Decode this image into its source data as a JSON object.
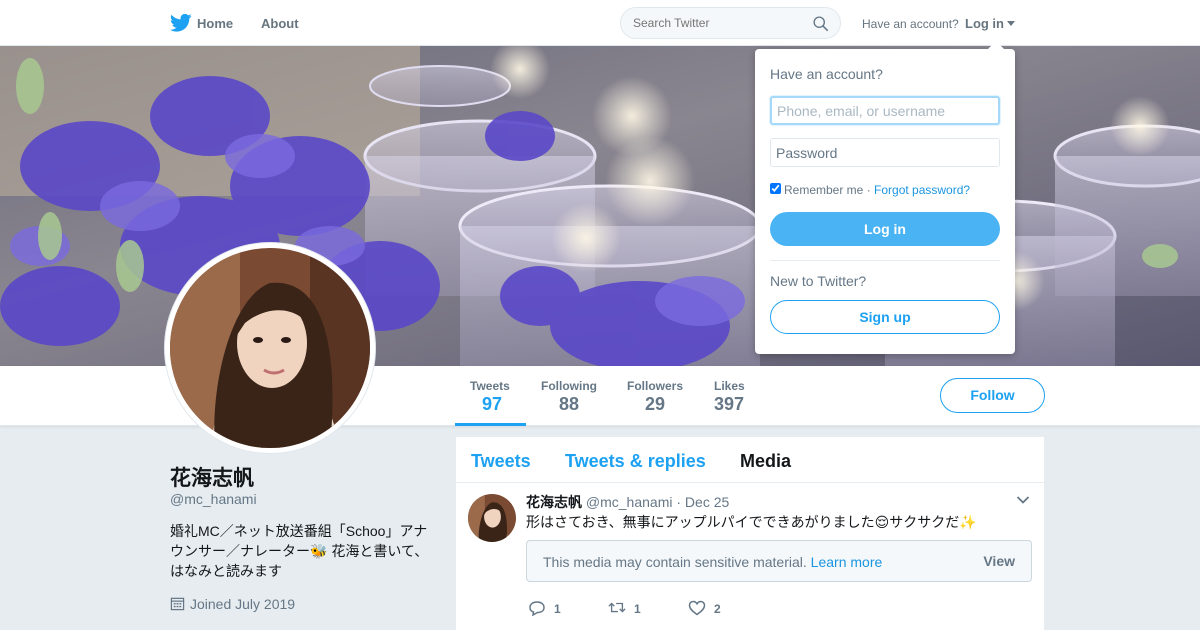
{
  "nav": {
    "home_label": "Home",
    "about_label": "About",
    "search_placeholder": "Search Twitter",
    "have_account": "Have an account?",
    "login_label": "Log in"
  },
  "stats": [
    {
      "label": "Tweets",
      "value": "97"
    },
    {
      "label": "Following",
      "value": "88"
    },
    {
      "label": "Followers",
      "value": "29"
    },
    {
      "label": "Likes",
      "value": "397"
    }
  ],
  "follow_label": "Follow",
  "profile": {
    "name": "花海志帆",
    "handle": "@mc_hanami",
    "bio": "婚礼MC／ネット放送番組「Schoo」アナウンサー／ナレーター🐝 花海と書いて、はなみと読みます",
    "joined": "Joined July 2019"
  },
  "timeline": {
    "tabs": [
      "Tweets",
      "Tweets & replies",
      "Media"
    ],
    "tweet": {
      "name": "花海志帆",
      "handle": "@mc_hanami",
      "date": "Dec 25",
      "text": "形はさておき、無事にアップルパイでできあがりました😌サクサクだ✨",
      "media_warning": "This media may contain sensitive material.",
      "learn_more": "Learn more",
      "view_label": "View",
      "replies": "1",
      "retweets": "1",
      "likes": "2"
    }
  },
  "login_dropdown": {
    "title": "Have an account?",
    "username_placeholder": "Phone, email, or username",
    "password_placeholder": "Password",
    "remember_me": "Remember me",
    "separator": " · ",
    "forgot_password": "Forgot password?",
    "login_button": "Log in",
    "new_to_twitter": "New to Twitter?",
    "signup_button": "Sign up"
  },
  "colors": {
    "brand": "#1da1f2",
    "login_button": "#4ab3f4",
    "background": "#e6ecf0"
  },
  "icons": [
    "twitter-bird-icon",
    "search-icon",
    "caret-down-icon",
    "calendar-icon",
    "chevron-down-icon",
    "reply-icon",
    "retweet-icon",
    "heart-icon"
  ]
}
